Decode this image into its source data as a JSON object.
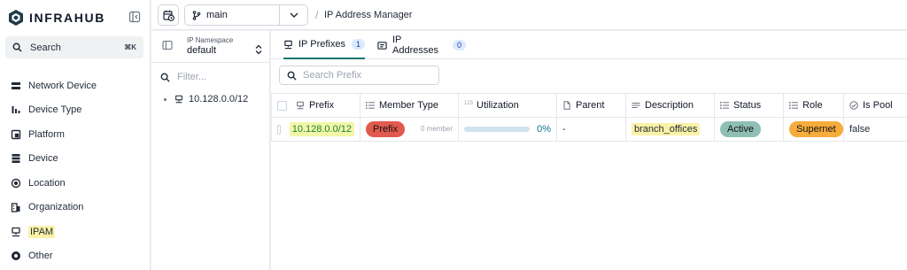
{
  "app": {
    "name": "INFRAHUB"
  },
  "sidebar": {
    "search_label": "Search",
    "search_shortcut": "⌘K",
    "items": [
      {
        "label": "Network Device",
        "icon": "server-rack-icon"
      },
      {
        "label": "Device Type",
        "icon": "bar-chart-icon"
      },
      {
        "label": "Platform",
        "icon": "platform-icon"
      },
      {
        "label": "Device",
        "icon": "device-stack-icon"
      },
      {
        "label": "Location",
        "icon": "location-pin-icon"
      },
      {
        "label": "Organization",
        "icon": "building-icon"
      },
      {
        "label": "IPAM",
        "icon": "ipam-icon",
        "highlighted": true
      },
      {
        "label": "Other",
        "icon": "other-icon"
      }
    ]
  },
  "topbar": {
    "branch": "main",
    "title": "IP Address Manager"
  },
  "namespace": {
    "label": "IP Namespace",
    "value": "default",
    "filter_placeholder": "Filter...",
    "tree": [
      "10.128.0.0/12"
    ]
  },
  "tabs": [
    {
      "label": "IP Prefixes",
      "count": "1",
      "active": true
    },
    {
      "label": "IP Addresses",
      "count": "0",
      "active": false
    }
  ],
  "search": {
    "placeholder": "Search Prefix"
  },
  "table": {
    "columns": [
      "Prefix",
      "Member Type",
      "Utilization",
      "Parent",
      "Description",
      "Status",
      "Role",
      "Is Pool"
    ],
    "rows": [
      {
        "prefix": "10.128.0.0/12",
        "member_type": "Prefix",
        "member_count": "0 member",
        "utilization": "0%",
        "utilization_fraction": 0,
        "parent": "-",
        "description": "branch_offices",
        "status": "Active",
        "role": "Supernet",
        "is_pool": "false"
      }
    ]
  },
  "colors": {
    "accent": "#0f766e",
    "prefix_pill": "#e25a4f",
    "active_pill": "#8fbfb4",
    "role_pill": "#f6ad3c",
    "highlight": "#fbf2a8"
  }
}
